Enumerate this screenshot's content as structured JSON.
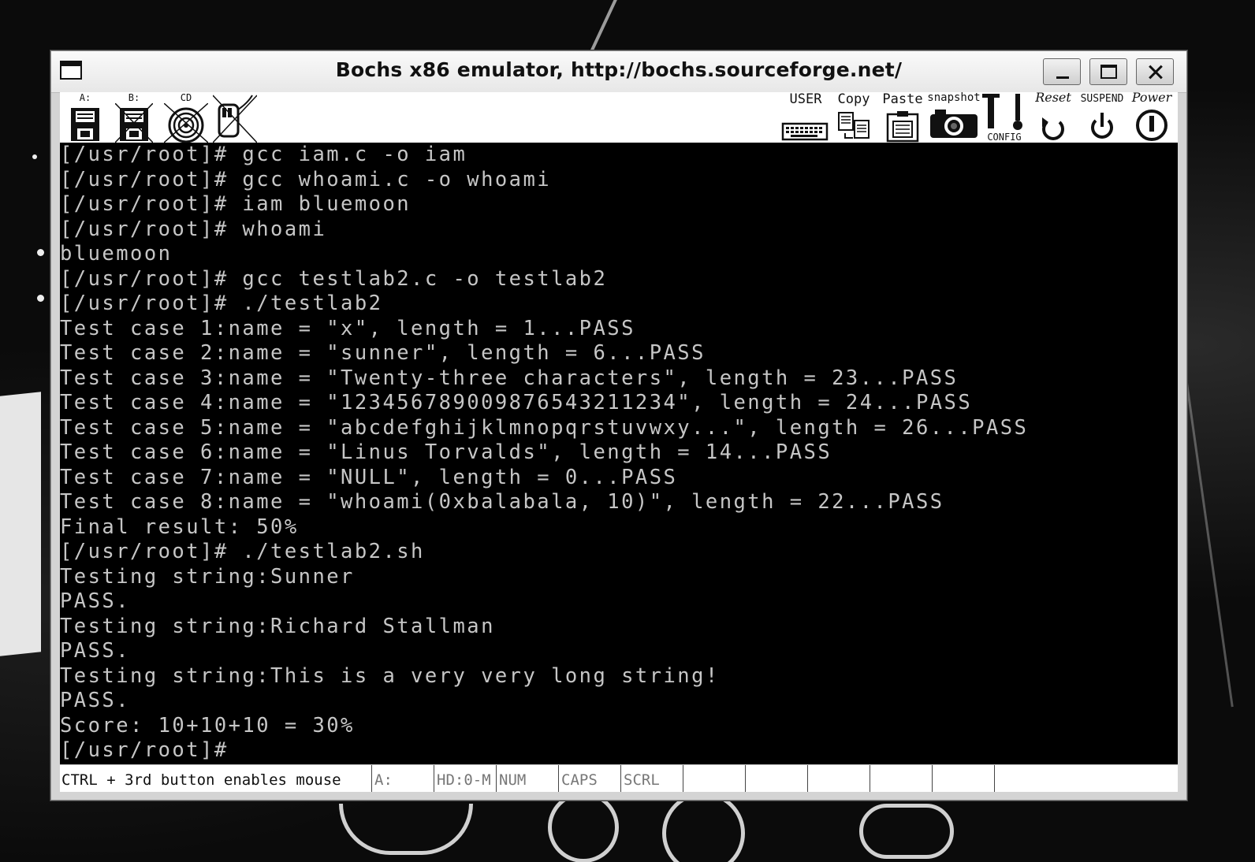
{
  "window": {
    "title": "Bochs x86 emulator, http://bochs.sourceforge.net/"
  },
  "toolbar": {
    "floppy_a_label": "A:",
    "floppy_b_label": "B:",
    "cdrom_label": "CD",
    "user_label": "USER",
    "copy_label": "Copy",
    "paste_label": "Paste",
    "snapshot_label": "snapshot",
    "config_label": "CONFIG",
    "reset_label": "Reset",
    "suspend_label": "SUSPEND",
    "power_label": "Power"
  },
  "terminal": {
    "lines": [
      "[/usr/root]# gcc iam.c -o iam",
      "[/usr/root]# gcc whoami.c -o whoami",
      "[/usr/root]# iam bluemoon",
      "[/usr/root]# whoami",
      "bluemoon",
      "[/usr/root]# gcc testlab2.c -o testlab2",
      "[/usr/root]# ./testlab2",
      "Test case 1:name = \"x\", length = 1...PASS",
      "Test case 2:name = \"sunner\", length = 6...PASS",
      "Test case 3:name = \"Twenty-three characters\", length = 23...PASS",
      "Test case 4:name = \"123456789009876543211234\", length = 24...PASS",
      "Test case 5:name = \"abcdefghijklmnopqrstuvwxy...\", length = 26...PASS",
      "Test case 6:name = \"Linus Torvalds\", length = 14...PASS",
      "Test case 7:name = \"NULL\", length = 0...PASS",
      "Test case 8:name = \"whoami(0xbalabala, 10)\", length = 22...PASS",
      "Final result: 50%",
      "[/usr/root]# ./testlab2.sh",
      "Testing string:Sunner",
      "PASS.",
      "Testing string:Richard Stallman",
      "PASS.",
      "Testing string:This is a very very long string!",
      "PASS.",
      "Score: 10+10+10 = 30%",
      "[/usr/root]#"
    ],
    "fg_color": "#c6c6c6",
    "bg_color": "#000000"
  },
  "statusbar": {
    "hint": "CTRL + 3rd button enables mouse",
    "floppy_a": "A:",
    "hd": "HD:0-M",
    "num": "NUM",
    "caps": "CAPS",
    "scrl": "SCRL"
  }
}
